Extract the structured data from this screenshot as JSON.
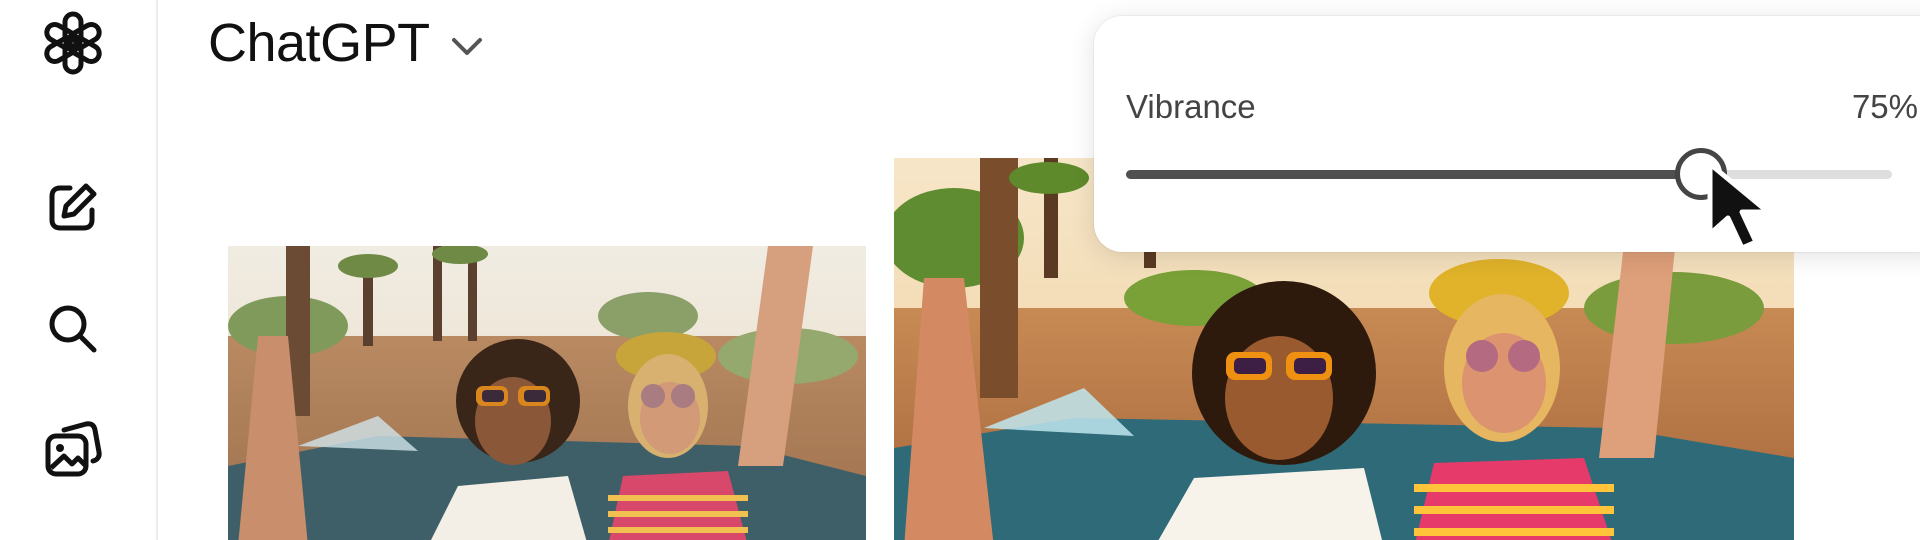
{
  "app": {
    "model_name": "ChatGPT"
  },
  "sidebar": {
    "items": [
      {
        "name": "new-chat",
        "icon": "pencil-square-icon"
      },
      {
        "name": "search",
        "icon": "search-icon"
      },
      {
        "name": "library",
        "icon": "images-icon"
      }
    ]
  },
  "slider": {
    "label": "Vibrance",
    "value_text": "75%",
    "fraction": 0.75
  },
  "photos": [
    {
      "name": "original-photo"
    },
    {
      "name": "edited-photo"
    }
  ],
  "colors": {
    "track": "#dedede",
    "track_fill": "#505050",
    "thumb_border": "#454545",
    "sidebar_border": "#ececec"
  }
}
